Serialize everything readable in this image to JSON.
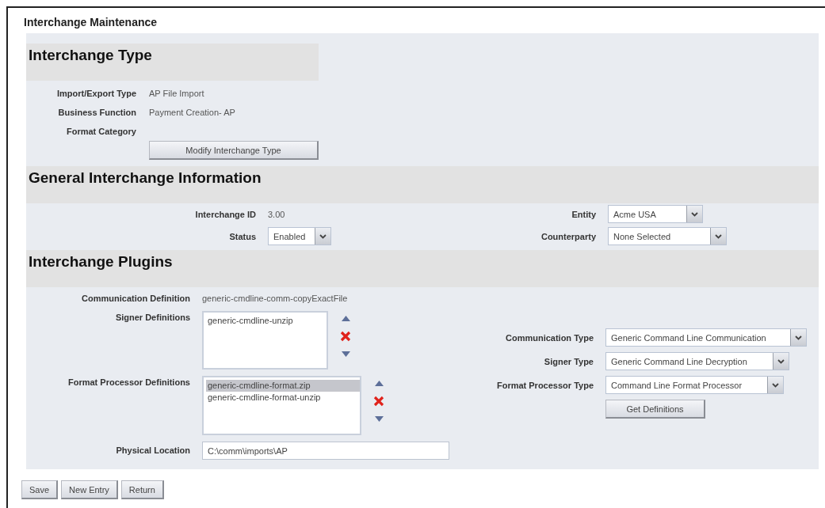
{
  "page_title": "Interchange Maintenance",
  "interchange_type": {
    "heading": "Interchange Type",
    "fields": [
      {
        "label": "Import/Export Type",
        "value": "AP File Import"
      },
      {
        "label": "Business Function",
        "value": "Payment Creation- AP"
      },
      {
        "label": "Format Category"
      }
    ],
    "button": "Modify Interchange Type"
  },
  "general_information": {
    "heading": "General Interchange Information",
    "interchange_id": {
      "label": "Interchange ID",
      "value": "3.00"
    },
    "status": {
      "label": "Status",
      "value": "Enabled"
    },
    "entity": {
      "label": "Entity",
      "value": "Acme USA"
    },
    "counterparty": {
      "label": "Counterparty",
      "value": "None Selected"
    }
  },
  "plugins": {
    "heading": "Interchange Plugins",
    "communication_definition": {
      "label": "Communication Definition",
      "value": "generic-cmdline-comm-copyExactFile"
    },
    "signer_definitions": {
      "label": "Signer Definitions",
      "items": [
        {
          "text": "generic-cmdline-unzip",
          "selected": false
        }
      ]
    },
    "format_processor_definitions": {
      "label": "Format Processor Definitions",
      "items": [
        {
          "text": "generic-cmdline-format.zip",
          "selected": true
        },
        {
          "text": "generic-cmdline-format-unzip",
          "selected": false
        }
      ]
    },
    "physical_location": {
      "label": "Physical Location",
      "value": "C:\\comm\\imports\\AP"
    },
    "communication_type": {
      "label": "Communication Type",
      "value": "Generic Command Line Communication"
    },
    "signer_type": {
      "label": "Signer Type",
      "value": "Generic Command Line Decryption"
    },
    "format_processor_type": {
      "label": "Format Processor Type",
      "value": "Command Line Format Processor"
    },
    "button": "Get Definitions"
  },
  "buttons": [
    "Save",
    "New Entry",
    "Return"
  ]
}
